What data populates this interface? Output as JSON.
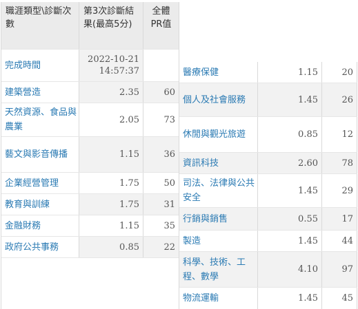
{
  "table": {
    "headers": {
      "category": "職涯類型\\診斷次數",
      "result": "第3次診斷結果(最高5分)",
      "pr": "全體PR值"
    },
    "completion_label": "完成時間",
    "completion_time": "2022-10-21 14:57:37",
    "left_rows": [
      {
        "name": "建築營造",
        "score": "2.35",
        "pr": "60"
      },
      {
        "name": "天然資源、食品與農業",
        "score": "2.05",
        "pr": "73"
      },
      {
        "name": "藝文與影音傳播",
        "score": "1.15",
        "pr": "36"
      },
      {
        "name": "企業經營管理",
        "score": "1.75",
        "pr": "50"
      },
      {
        "name": "教育與訓練",
        "score": "1.75",
        "pr": "31"
      },
      {
        "name": "金融財務",
        "score": "1.15",
        "pr": "35"
      },
      {
        "name": "政府公共事務",
        "score": "0.85",
        "pr": "22"
      }
    ],
    "right_rows": [
      {
        "name": "醫療保健",
        "score": "1.15",
        "pr": "20"
      },
      {
        "name": "個人及社會服務",
        "score": "1.45",
        "pr": "26"
      },
      {
        "name": "休閒與觀光旅遊",
        "score": "0.85",
        "pr": "12"
      },
      {
        "name": "資訊科技",
        "score": "2.60",
        "pr": "78"
      },
      {
        "name": "司法、法律與公共安全",
        "score": "1.45",
        "pr": "29"
      },
      {
        "name": "行銷與銷售",
        "score": "0.55",
        "pr": "17"
      },
      {
        "name": "製造",
        "score": "1.45",
        "pr": "44"
      },
      {
        "name": "科學、技術、工程、數學",
        "score": "4.10",
        "pr": "97"
      },
      {
        "name": "物流運輸",
        "score": "1.45",
        "pr": "45"
      }
    ]
  }
}
